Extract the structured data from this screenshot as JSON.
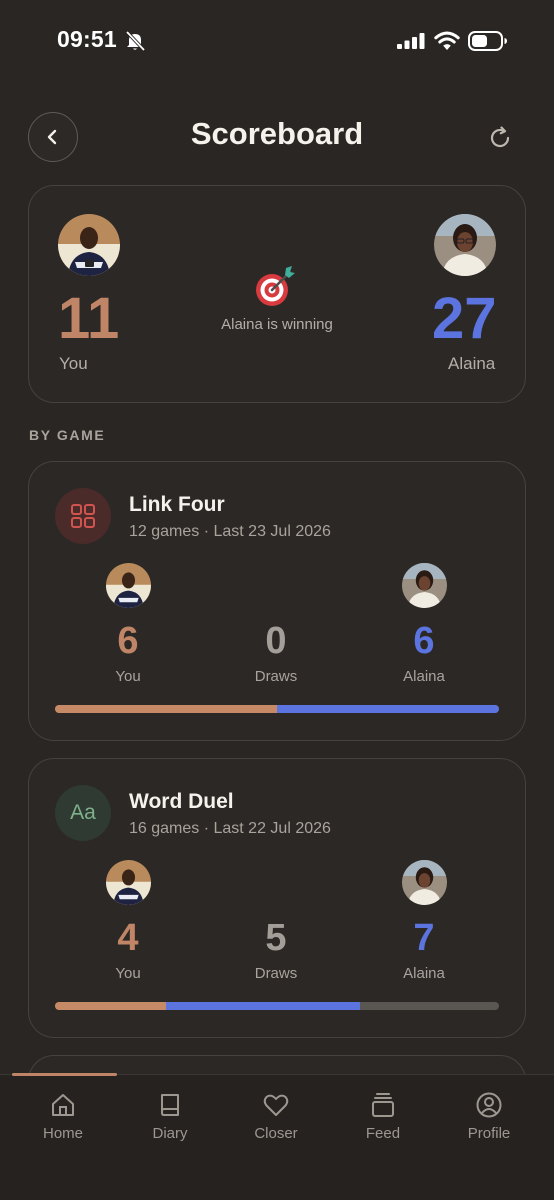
{
  "status_bar": {
    "time": "09:51"
  },
  "header": {
    "title": "Scoreboard",
    "back_icon": "chevron-left-icon",
    "refresh_icon": "refresh-icon"
  },
  "overall": {
    "you_score": "11",
    "you_label": "You",
    "opponent_score": "27",
    "opponent_label": "Alaina",
    "status_text": "Alaina is winning",
    "status_icon": "target-dart-icon"
  },
  "section_label": "BY GAME",
  "games": [
    {
      "name": "Link Four",
      "meta": "12 games · Last 23 Jul 2026",
      "icon": "grid-icon",
      "you_score": "6",
      "draws": "0",
      "opponent_score": "6",
      "you_label": "You",
      "draws_label": "Draws",
      "opponent_label": "Alaina",
      "bar": {
        "you": 0.5,
        "opponent": 0.5,
        "draws": 0
      }
    },
    {
      "name": "Word Duel",
      "meta": "16 games · Last 22 Jul 2026",
      "icon": "letters-aa-icon",
      "icon_text": "Aa",
      "you_score": "4",
      "draws": "5",
      "opponent_score": "7",
      "you_label": "You",
      "draws_label": "Draws",
      "opponent_label": "Alaina",
      "bar": {
        "you": 0.25,
        "opponent": 0.4375,
        "draws": 0.3125
      }
    }
  ],
  "nav": [
    {
      "label": "Home",
      "icon": "home-icon"
    },
    {
      "label": "Diary",
      "icon": "book-icon"
    },
    {
      "label": "Closer",
      "icon": "heart-icon"
    },
    {
      "label": "Feed",
      "icon": "stack-icon"
    },
    {
      "label": "Profile",
      "icon": "user-circle-icon"
    }
  ],
  "colors": {
    "background": "#292623",
    "you": "#c08566",
    "opponent": "#5b74df",
    "draws": "#a39e98",
    "card_border": "#46423e"
  }
}
